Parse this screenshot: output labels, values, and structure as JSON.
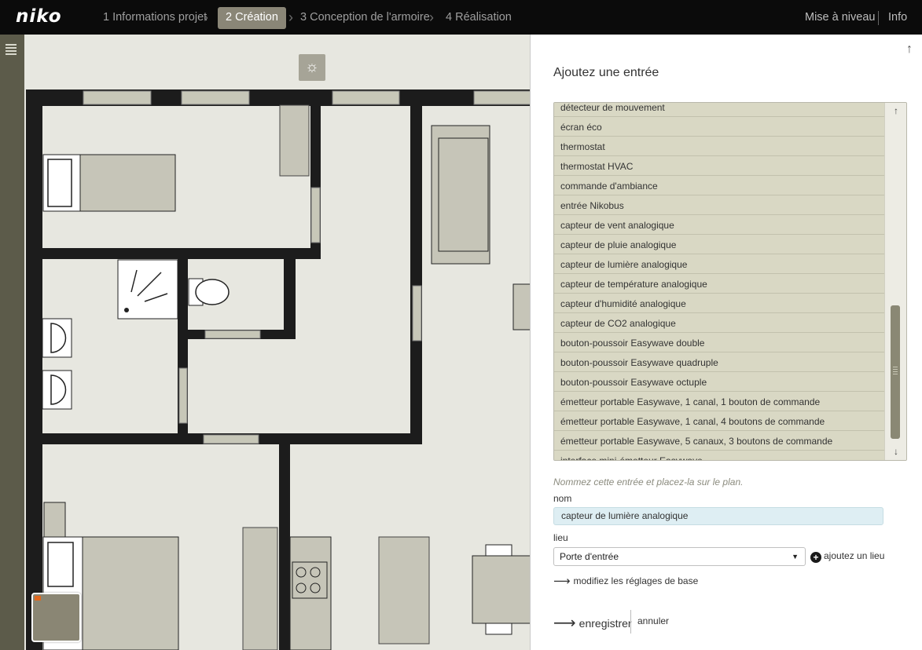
{
  "header": {
    "logo": "niko",
    "steps": [
      {
        "label": "1 Informations projet"
      },
      {
        "label": "2 Création"
      },
      {
        "label": "3 Conception de l'armoire"
      },
      {
        "label": "4 Réalisation"
      }
    ],
    "links": {
      "upgrade": "Mise à niveau",
      "info": "Info"
    }
  },
  "plan": {
    "sun_icon": "☼"
  },
  "panel": {
    "title": "Ajoutez une entrée",
    "list_items": [
      "détecteur de mouvement",
      "écran éco",
      "thermostat",
      "thermostat HVAC",
      "commande d'ambiance",
      "entrée Nikobus",
      "capteur de vent analogique",
      "capteur de pluie analogique",
      "capteur de lumière analogique",
      "capteur de température analogique",
      "capteur d'humidité analogique",
      "capteur de CO2 analogique",
      "bouton-poussoir Easywave double",
      "bouton-poussoir Easywave quadruple",
      "bouton-poussoir Easywave octuple",
      "émetteur portable Easywave, 1 canal, 1 bouton de commande",
      "émetteur portable Easywave, 1 canal, 4 boutons de commande",
      "émetteur portable Easywave, 5 canaux, 3 boutons de commande",
      "interface mini-émetteur Easywave"
    ],
    "hint": "Nommez cette entrée et placez-la sur le plan.",
    "name_label": "nom",
    "name_value": "capteur de lumière analogique",
    "location_label": "lieu",
    "location_value": "Porte d'entrée",
    "add_location": "ajoutez un lieu",
    "modify_settings": "modifiez les réglages de base",
    "save": "enregistrer",
    "cancel": "annuler"
  }
}
